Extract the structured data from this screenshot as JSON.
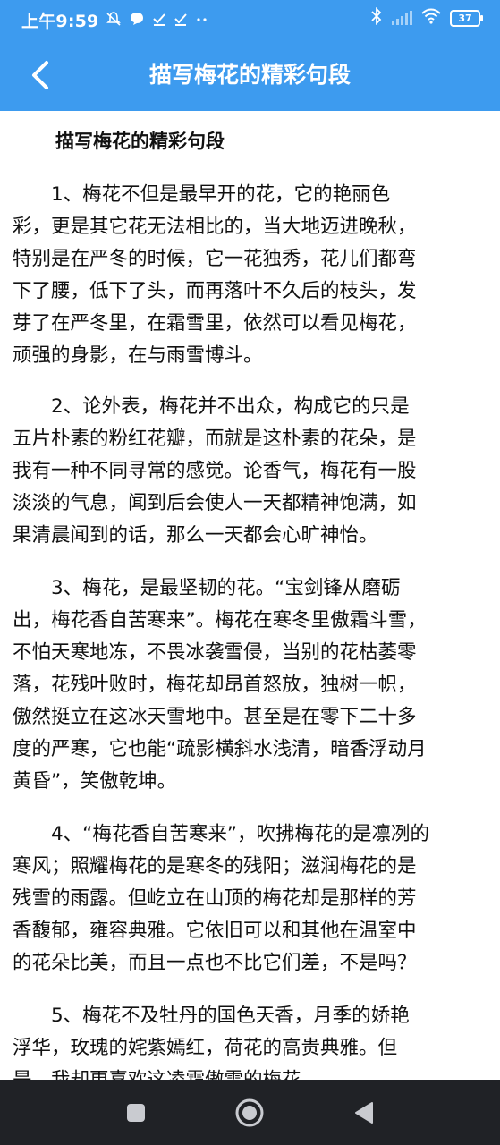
{
  "status_bar": {
    "time": "上午9:59",
    "left_icons": [
      "mute-icon",
      "chat-bubble-icon",
      "download-done-icon",
      "download-done-icon",
      "more-dots-icon"
    ],
    "battery": "37"
  },
  "toolbar": {
    "title": "描写梅花的精彩句段"
  },
  "article": {
    "heading": "描写梅花的精彩句段",
    "paragraphs": [
      {
        "lines": [
          "　　1、梅花不但是最早开的花，它的艳丽色",
          "彩，更是其它花无法相比的，当大地迈进晚秋，",
          "特别是在严冬的时候，它一花独秀，花儿们都弯",
          "下了腰，低下了头，而再落叶不久后的枝头，发",
          "芽了在严冬里，在霜雪里，依然可以看见梅花，",
          "顽强的身影，在与雨雪博斗。"
        ]
      },
      {
        "lines": [
          "　　2、论外表，梅花并不出众，构成它的只是",
          "五片朴素的粉红花瓣，而就是这朴素的花朵，是",
          "我有一种不同寻常的感觉。论香气，梅花有一股",
          "淡淡的气息，闻到后会使人一天都精神饱满，如",
          "果清晨闻到的话，那么一天都会心旷神怡。"
        ]
      },
      {
        "lines": [
          "　　3、梅花，是最坚韧的花。“宝剑锋从磨砺",
          "出，梅花香自苦寒来”。梅花在寒冬里傲霜斗雪，",
          "不怕天寒地冻，不畏冰袭雪侵，当别的花枯萎零",
          "落，花残叶败时，梅花却昂首怒放，独树一帜，",
          "傲然挺立在这冰天雪地中。甚至是在零下二十多",
          "度的严寒，它也能“疏影横斜水浅清，暗香浮动月",
          "黄昏”，笑傲乾坤。"
        ]
      },
      {
        "lines": [
          "　　4、“梅花香自苦寒来”，吹拂梅花的是凛冽的",
          "寒风；照耀梅花的是寒冬的残阳；滋润梅花的是",
          "残雪的雨露。但屹立在山顶的梅花却是那样的芳",
          "香馥郁，雍容典雅。它依旧可以和其他在温室中",
          "的花朵比美，而且一点也不比它们差，不是吗？"
        ]
      },
      {
        "lines": [
          "　　5、梅花不及牡丹的国色天香，月季的娇艳",
          "浮华，玫瑰的姹紫嫣红，荷花的高贵典雅。但",
          "是，我却更喜欢这凌霜傲雪的梅花。"
        ]
      }
    ]
  },
  "nav_bar": {
    "buttons": [
      "recents-square-icon",
      "home-circle-icon",
      "back-triangle-icon"
    ]
  },
  "colors": {
    "accent": "#3d9bef",
    "nav_background": "#202226",
    "text": "#111111"
  }
}
